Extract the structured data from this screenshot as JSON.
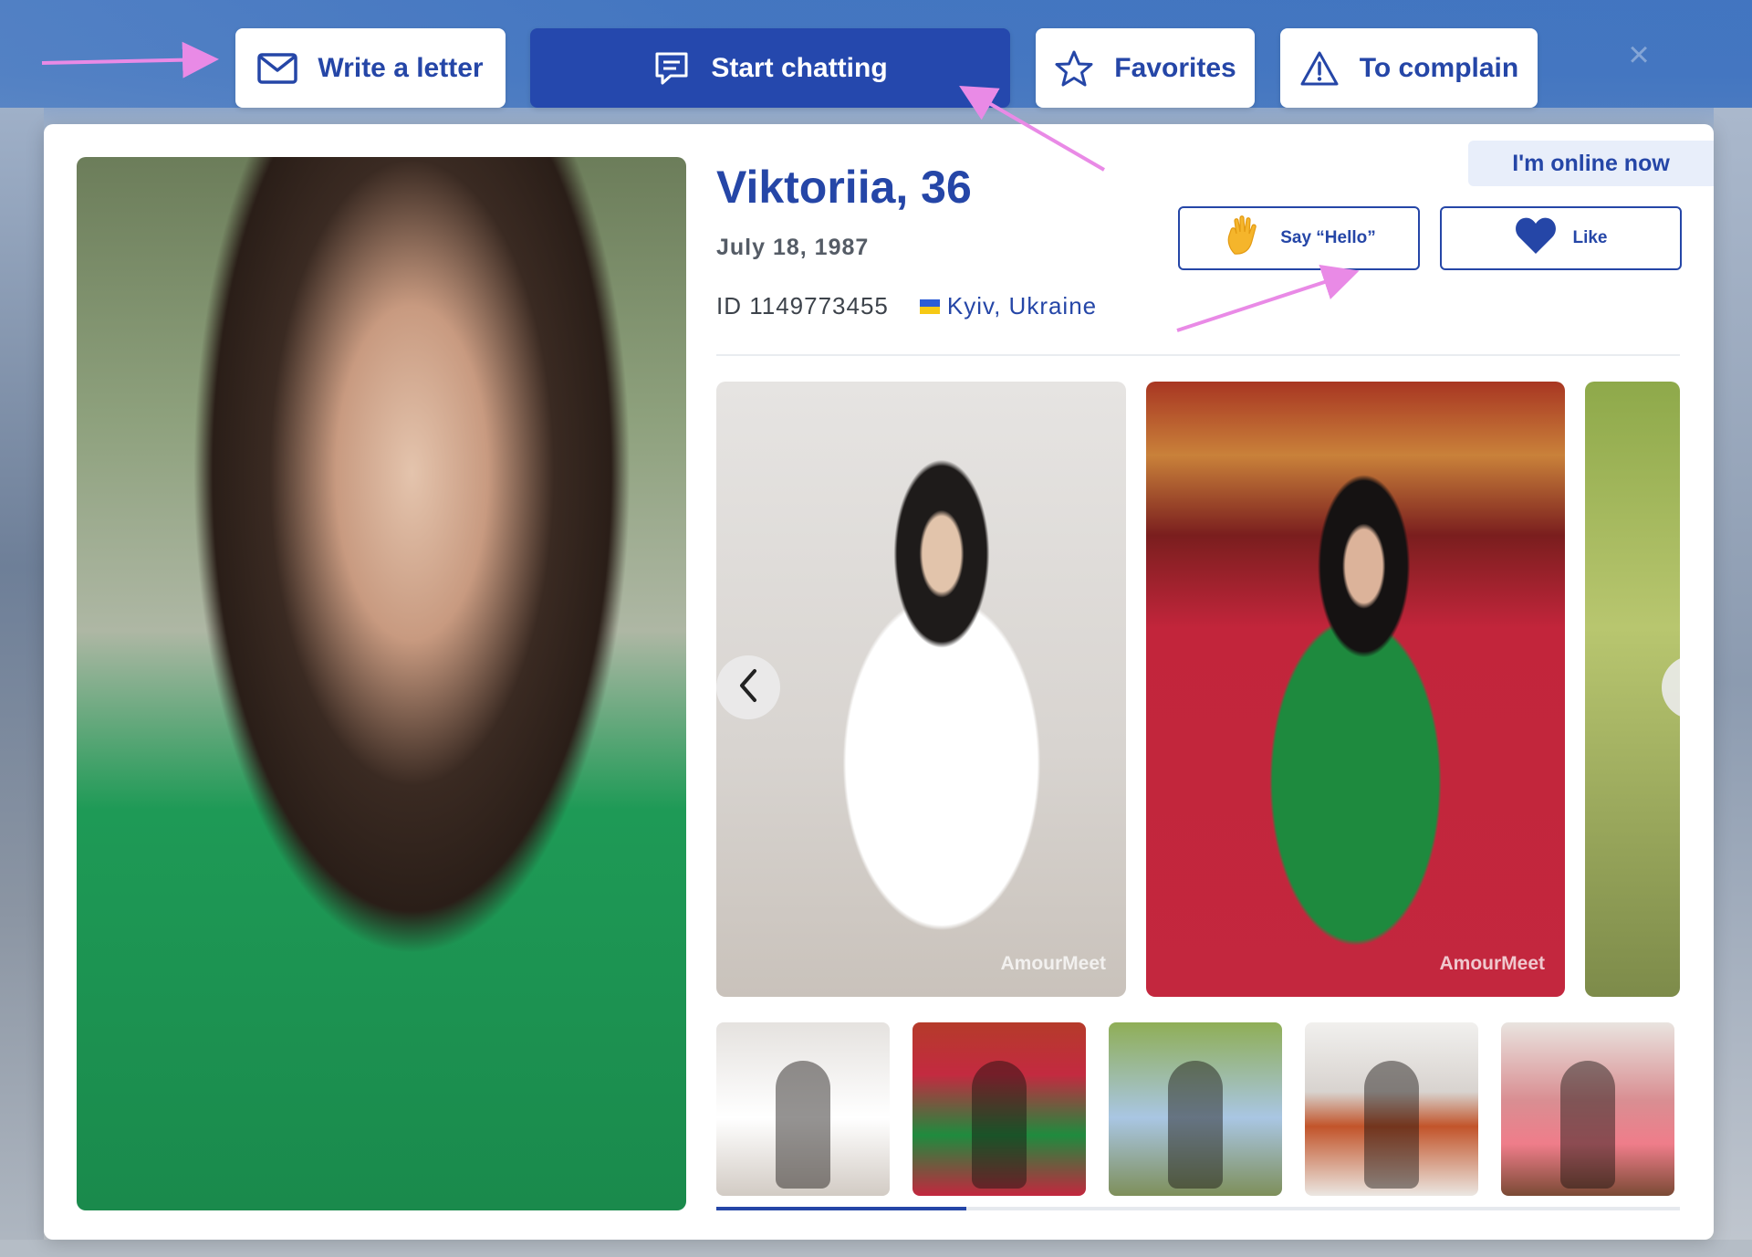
{
  "toolbar": {
    "write_letter": "Write a letter",
    "start_chatting": "Start chatting",
    "favorites": "Favorites",
    "complain": "To complain"
  },
  "profile": {
    "name_age": "Viktoriia, 36",
    "birth_date": "July 18, 1987",
    "id_text": "ID 1149773455",
    "location": "Kyiv, Ukraine",
    "online_status": "I'm online now"
  },
  "actions": {
    "say_hello": "Say “Hello”",
    "like": "Like"
  },
  "gallery": {
    "watermark": "AmourMeet",
    "thumbnail_count": 5
  },
  "icons": [
    "envelope-icon",
    "chat-icon",
    "star-icon",
    "warning-icon",
    "waving-hand-icon",
    "heart-icon",
    "chevron-left-icon",
    "chevron-right-icon",
    "close-icon"
  ],
  "colors": {
    "primary": "#2546a7",
    "online_badge_bg": "#e8eefa",
    "annotation_arrow": "#e98ae6",
    "hand_emoji": "#f5b52b"
  }
}
